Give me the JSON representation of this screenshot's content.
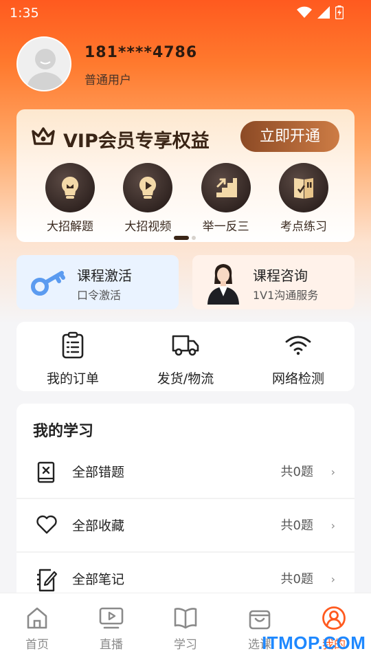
{
  "status_bar": {
    "time": "1:35"
  },
  "profile": {
    "phone": "181****4786",
    "user_type": "普通用户"
  },
  "vip": {
    "title": "VIP会员专享权益",
    "button": "立即开通",
    "items": [
      {
        "label": "大招解题",
        "icon": "bulb-icon"
      },
      {
        "label": "大招视频",
        "icon": "play-bulb-icon"
      },
      {
        "label": "举一反三",
        "icon": "stairs-icon"
      },
      {
        "label": "考点练习",
        "icon": "notebook-check-icon"
      }
    ]
  },
  "cards": {
    "activate": {
      "title": "课程激活",
      "subtitle": "口令激活"
    },
    "consult": {
      "title": "课程咨询",
      "subtitle": "1V1沟通服务"
    }
  },
  "quick": [
    {
      "label": "我的订单",
      "icon": "clipboard-icon"
    },
    {
      "label": "发货/物流",
      "icon": "truck-icon"
    },
    {
      "label": "网络检测",
      "icon": "wifi-icon"
    }
  ],
  "learning": {
    "title": "我的学习",
    "rows": [
      {
        "label": "全部错题",
        "count": "共0题",
        "icon": "wrong-book-icon"
      },
      {
        "label": "全部收藏",
        "count": "共0题",
        "icon": "heart-icon"
      },
      {
        "label": "全部笔记",
        "count": "共0题",
        "icon": "note-icon"
      }
    ]
  },
  "nav": [
    {
      "label": "首页",
      "icon": "home-icon"
    },
    {
      "label": "直播",
      "icon": "live-icon"
    },
    {
      "label": "学习",
      "icon": "book-icon"
    },
    {
      "label": "选课",
      "icon": "bag-icon"
    },
    {
      "label": "我的",
      "icon": "profile-icon",
      "active": true
    }
  ],
  "watermark": "ITMOP.COM",
  "colors": {
    "accent": "#ff5a1f",
    "vip_brown": "#3a2516"
  }
}
